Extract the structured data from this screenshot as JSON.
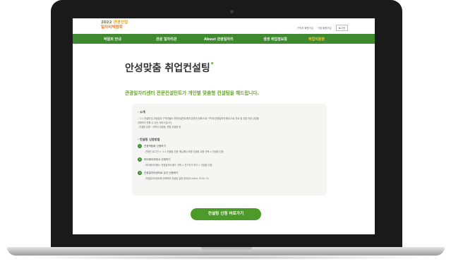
{
  "site": {
    "logo_line1_year": "2022",
    "logo_line1_text": "관광산업",
    "logo_line2": "일자리박람회"
  },
  "utility": {
    "link1": "구직자 회원가입",
    "link2": "기업 회원가입",
    "button": "로그인"
  },
  "nav": {
    "items": [
      {
        "label": "박람회 안내"
      },
      {
        "label": "관광 일자리관"
      },
      {
        "label": "About 관광일자리"
      },
      {
        "label": "생생 취업정보통"
      },
      {
        "label": "취업지원관"
      }
    ],
    "active_index": 4
  },
  "page": {
    "title": "안성맞춤 취업컨설팅",
    "subtitle": "관광일자리센터 전문컨설턴트가 개인별 맞춤형 컨설팅을 해드립니다."
  },
  "overview": {
    "heading": "· 소개",
    "lines": [
      "- '1:1 컨설팅'은 관광분야 구직자들의 전문컨설턴트에게 온라인(전화)으로 구직자(관광일자리센터)으로 진로 및 취업 관련 상담을",
      "  신청하고 받을 수 있는 서비스입니다.",
      "- 컨설팅 유형 : 이력서 컨설팅, 면접 컨설팅 등"
    ]
  },
  "apply": {
    "heading": "· 컨설팅 신청방법",
    "steps": [
      {
        "num": "1",
        "title": "관광박람회 신청하기",
        "desc": "- 관광인 로그인 > '1:1 컨설팅 신청' 메뉴에서 희망 컨설팅 유형 선택 > 컨설팅 신청"
      },
      {
        "num": "2",
        "title": "마이페이지에서 신청하기",
        "desc": "- 마이페이지에서 '관광일자리센터' 선택 > 친구추가 하기 > 컨설팅 신청"
      },
      {
        "num": "3",
        "title": "관광일자리센터로 유선 신청하기",
        "desc": "- 관광일자리센터에 연락하여 컨설팅 일정 문의(02-6441-3150~3)"
      }
    ]
  },
  "cta": {
    "label": "컨설팅 신청 바로가기"
  },
  "colors": {
    "nav_green": "#3f8a2f",
    "accent_green": "#6aa32f",
    "active_nav": "#ffcf3a",
    "cta_green": "#4c9a2a"
  }
}
